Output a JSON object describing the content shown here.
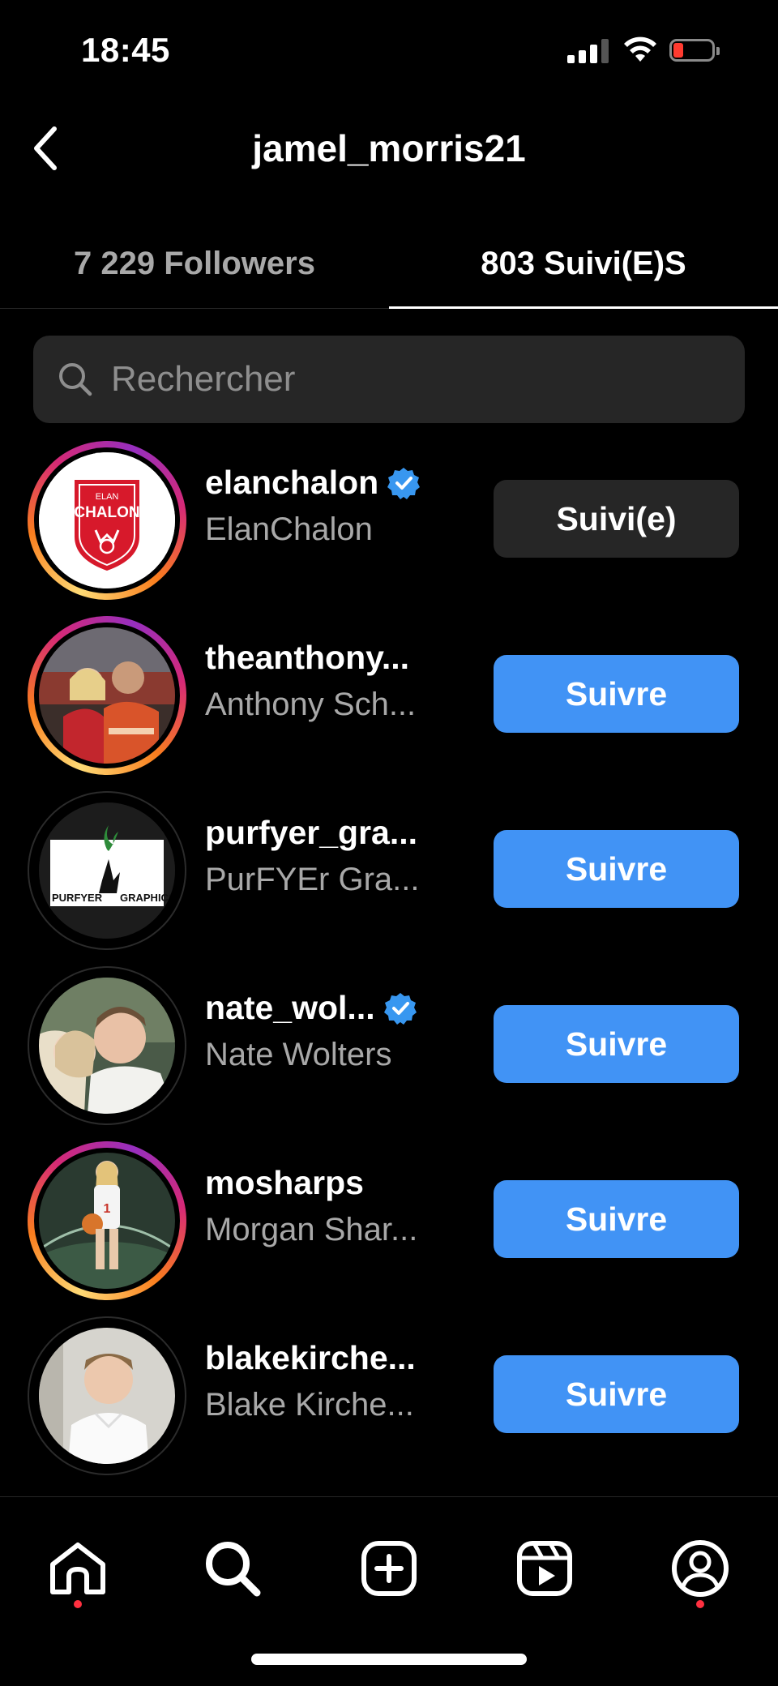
{
  "status_bar": {
    "time": "18:45"
  },
  "header": {
    "title": "jamel_morris21"
  },
  "tabs": [
    {
      "label": "7 229 Followers",
      "active": false
    },
    {
      "label": "803 Suivi(E)S",
      "active": true
    }
  ],
  "search": {
    "placeholder": "Rechercher"
  },
  "accounts": [
    {
      "username": "elanchalon",
      "fullname": "ElanChalon",
      "verified": true,
      "button": "Suivi(e)",
      "story_ring": true
    },
    {
      "username": "theanthony...",
      "fullname": "Anthony Sch...",
      "verified": false,
      "button": "Suivre",
      "story_ring": true
    },
    {
      "username": "purfyer_gra...",
      "fullname": "PurFYEr Gra...",
      "verified": false,
      "button": "Suivre",
      "story_ring": false
    },
    {
      "username": "nate_wol...",
      "fullname": "Nate Wolters",
      "verified": true,
      "button": "Suivre",
      "story_ring": false
    },
    {
      "username": "mosharps",
      "fullname": "Morgan Shar...",
      "verified": false,
      "button": "Suivre",
      "story_ring": true
    },
    {
      "username": "blakekirche...",
      "fullname": "Blake Kirche...",
      "verified": false,
      "button": "Suivre",
      "story_ring": false
    }
  ],
  "logo": {
    "elan_top": "ELAN",
    "elan_main": "CHALON",
    "purfyer_left": "PURFYER",
    "purfyer_right": "GRAPHICS"
  },
  "nav": [
    "home-icon",
    "search-icon",
    "create-icon",
    "reels-icon",
    "profile-icon"
  ],
  "colors": {
    "accent": "#4193f5",
    "verified": "#3897f0",
    "notification": "#ff3040"
  }
}
